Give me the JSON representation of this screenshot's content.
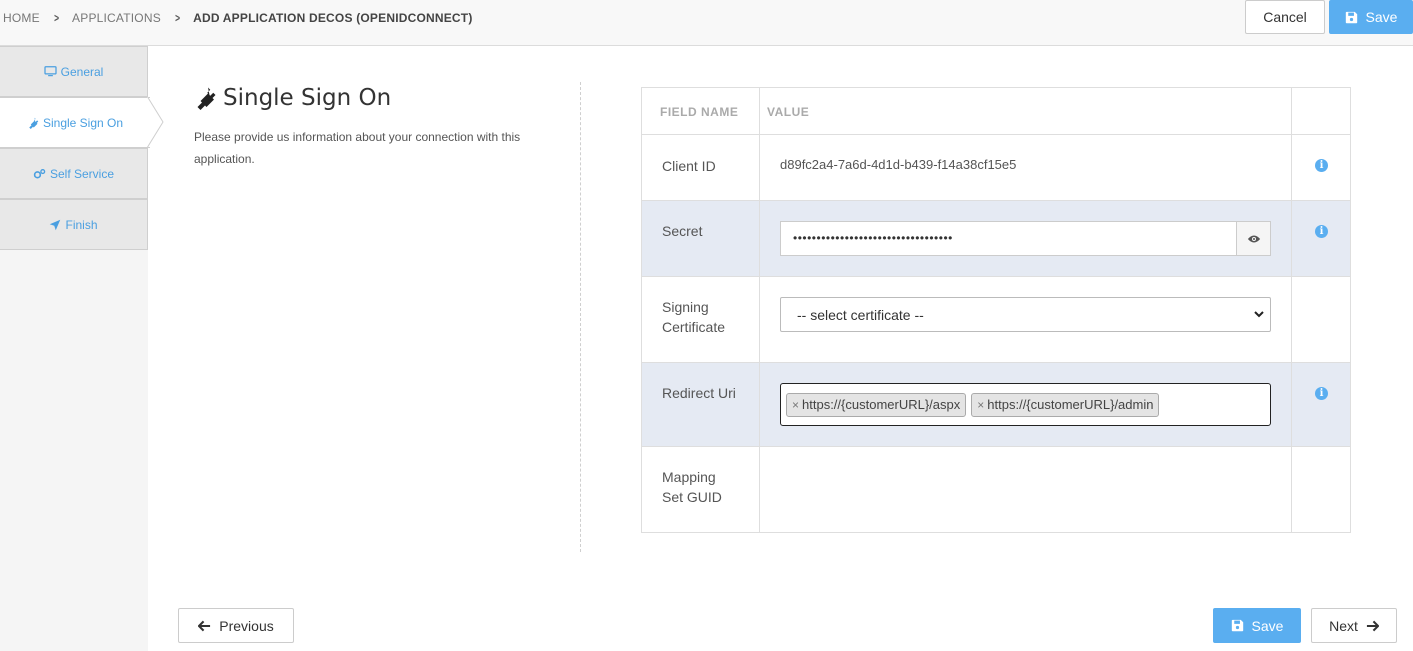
{
  "breadcrumb": {
    "home": "HOME",
    "applications": "APPLICATIONS",
    "current": "ADD APPLICATION DECOS (OPENIDCONNECT)"
  },
  "toolbar": {
    "cancel_label": "Cancel",
    "save_label": "Save"
  },
  "nav": {
    "items": [
      {
        "label": "General",
        "icon": "monitor-icon"
      },
      {
        "label": "Single Sign On",
        "icon": "plug-icon",
        "active": true
      },
      {
        "label": "Self Service",
        "icon": "gears-icon"
      },
      {
        "label": "Finish",
        "icon": "rocket-icon"
      }
    ]
  },
  "section": {
    "title": "Single Sign On",
    "description": "Please provide us information about your connection with this application."
  },
  "table": {
    "headers": {
      "field": "FIELD NAME",
      "value": "VALUE"
    },
    "client_id": {
      "label": "Client ID",
      "value": "d89fc2a4-7a6d-4d1d-b439-f14a38cf15e5"
    },
    "secret": {
      "label": "Secret",
      "value": "••••••••••••••••••••••••••••••••••"
    },
    "signing_certificate": {
      "label_line1": "Signing",
      "label_line2": "Certificate",
      "selected": "-- select certificate --"
    },
    "redirect_uri": {
      "label": "Redirect Uri",
      "tags": [
        "https://{customerURL}/aspx",
        "https://{customerURL}/admin"
      ]
    },
    "mapping_set": {
      "label_line1": "Mapping",
      "label_line2": "Set GUID"
    }
  },
  "footer": {
    "previous_label": "Previous",
    "save_label": "Save",
    "next_label": "Next"
  },
  "colors": {
    "accent": "#5aaef0",
    "shaded_row": "#e5eaf3"
  }
}
